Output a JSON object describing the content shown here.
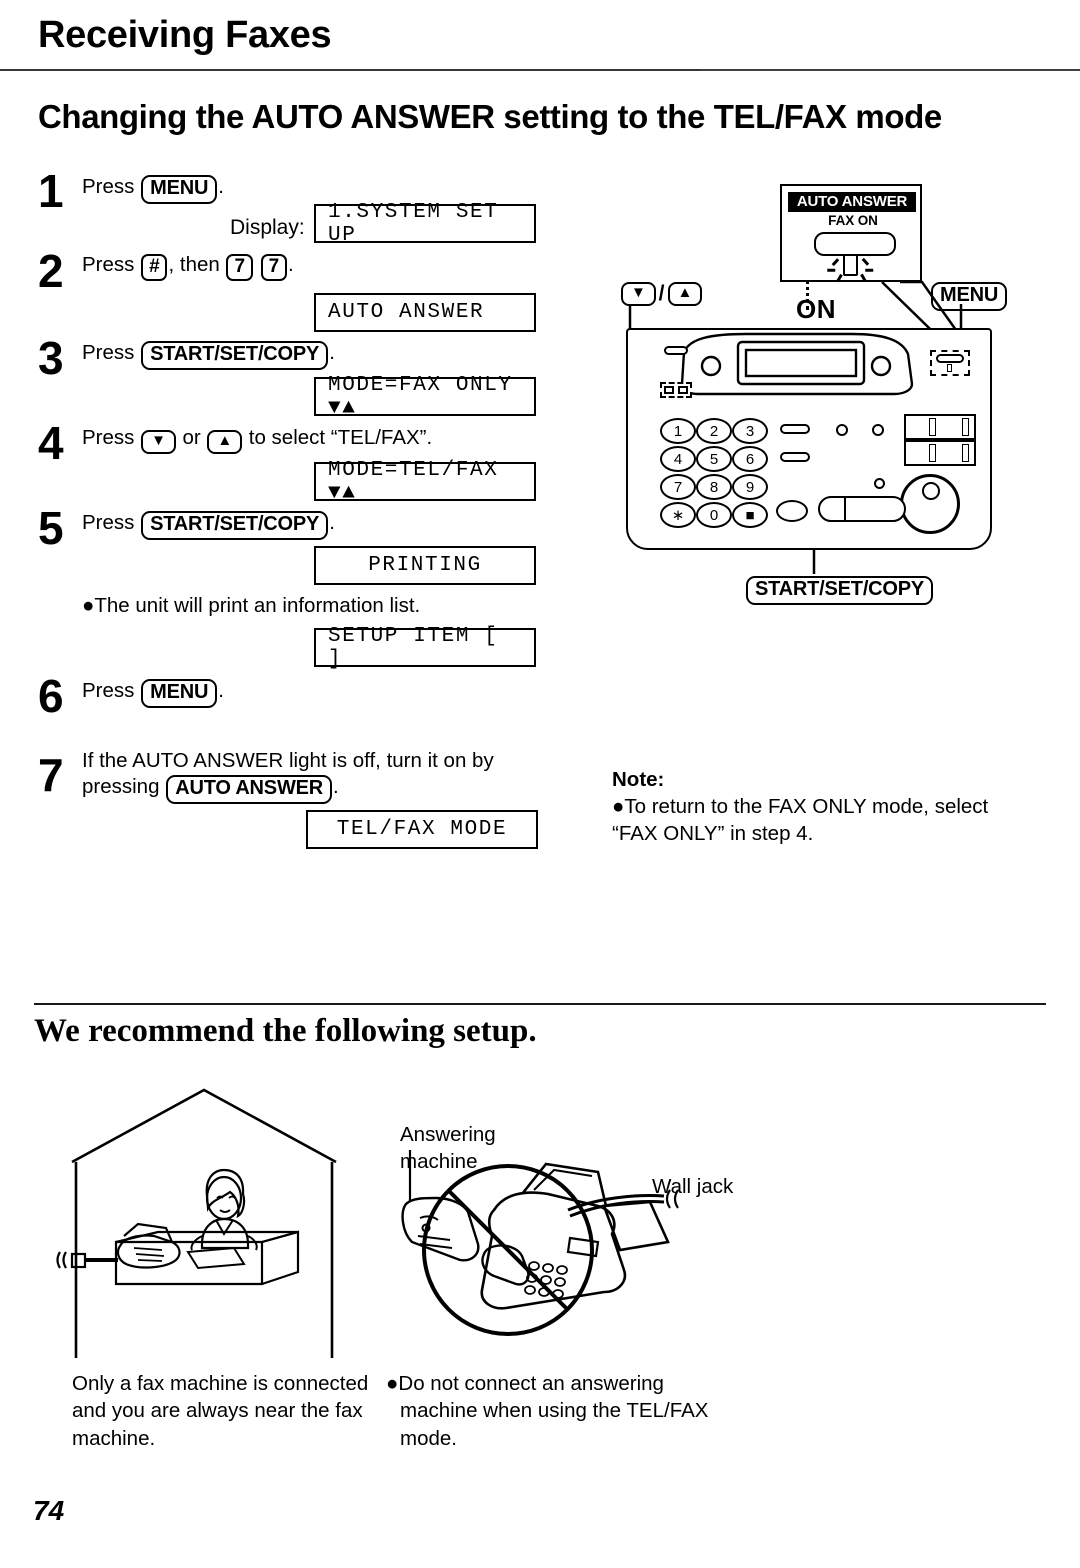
{
  "header": {
    "running_head": "Receiving Faxes",
    "section_title": "Changing the AUTO ANSWER setting to the TEL/FAX mode"
  },
  "steps": [
    {
      "number": "1",
      "text_before": "Press",
      "key": "MENU",
      "text_after": ".",
      "display_label": "Display:",
      "display": "1.SYSTEM SET UP"
    },
    {
      "number": "2",
      "text_before": "Press",
      "key": "#",
      "text_mid": ", then",
      "key2": "7",
      "key3": "7",
      "text_after": ".",
      "display": "AUTO ANSWER"
    },
    {
      "number": "3",
      "text_before": "Press",
      "key": "START/SET/COPY",
      "text_after": ".",
      "display": "MODE=FAX ONLY  ▼▲"
    },
    {
      "number": "4",
      "text_before": "Press",
      "key": "▼",
      "text_mid": "or",
      "key2": "▲",
      "text_after": "to select “TEL/FAX”.",
      "display": "MODE=TEL/FAX   ▼▲"
    },
    {
      "number": "5",
      "text_before": "Press",
      "key": "START/SET/COPY",
      "text_after": ".",
      "display": "PRINTING",
      "bullet": "●The unit will print an information list.",
      "display2": "SETUP ITEM [  ]"
    },
    {
      "number": "6",
      "text_before": "Press",
      "key": "MENU",
      "text_after": "."
    },
    {
      "number": "7",
      "line1_a": "If the AUTO ANSWER light is off, turn it on by",
      "line2_a": "pressing",
      "key": "AUTO ANSWER",
      "line2_b": ".",
      "display": "TEL/FAX MODE"
    }
  ],
  "note": {
    "title": "Note:",
    "body": "●To return to the FAX ONLY mode, select “FAX ONLY” in step 4."
  },
  "diagram": {
    "callout_badge": "AUTO ANSWER",
    "callout_sub": "FAX ON",
    "on_label": "ON",
    "arrow_down": "▼",
    "arrow_slash": "/",
    "arrow_up": "▲",
    "menu_key": "MENU",
    "start_key": "START/SET/COPY",
    "keypad": [
      "1",
      "2",
      "3",
      "4",
      "5",
      "6",
      "7",
      "8",
      "9",
      "∗",
      "0",
      "■"
    ]
  },
  "lower": {
    "heading": "We recommend the following setup.",
    "answering_machine_label": "Answering\nmachine",
    "wall_jack_label": "Wall jack",
    "caption_left": "Only a fax machine is connected and you are always near the fax machine.",
    "caption_right_bullet": "●",
    "caption_right": "Do not connect an answering machine when using the TEL/FAX mode."
  },
  "page_number": "74"
}
